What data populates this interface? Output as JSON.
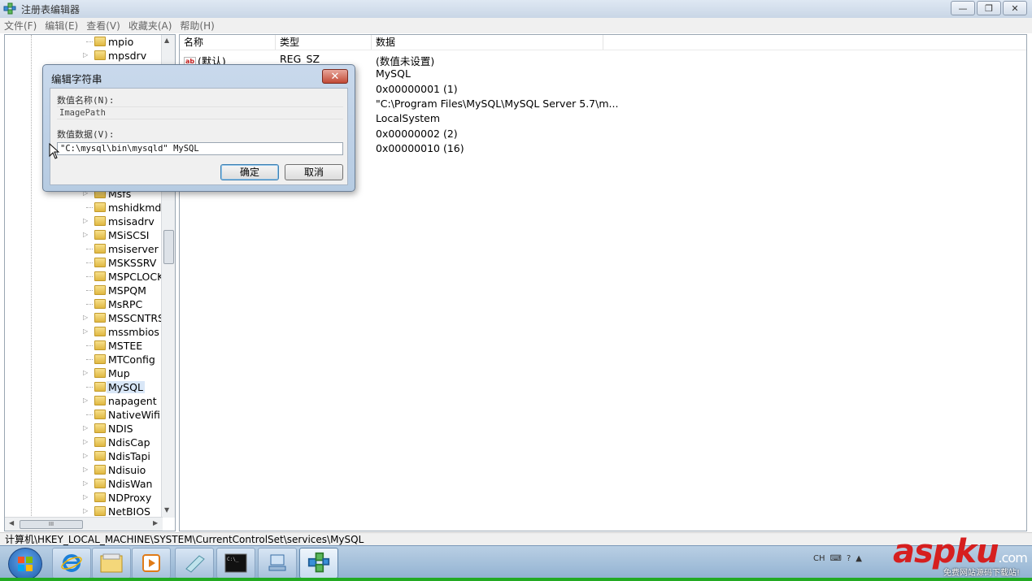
{
  "window": {
    "title": "注册表编辑器",
    "controls": {
      "minimize": "—",
      "maximize": "❐",
      "close": "✕"
    }
  },
  "menubar": {
    "items": [
      "文件(F)",
      "编辑(E)",
      "查看(V)",
      "收藏夹(A)",
      "帮助(H)"
    ]
  },
  "tree": {
    "items": [
      {
        "label": "mpio",
        "expandable": false
      },
      {
        "label": "mpsdrv",
        "expandable": true
      },
      {
        "label": "Msfs",
        "expandable": true
      },
      {
        "label": "mshidkmdf",
        "expandable": false
      },
      {
        "label": "msisadrv",
        "expandable": true
      },
      {
        "label": "MSiSCSI",
        "expandable": true
      },
      {
        "label": "msiserver",
        "expandable": false
      },
      {
        "label": "MSKSSRV",
        "expandable": false
      },
      {
        "label": "MSPCLOCK",
        "expandable": false
      },
      {
        "label": "MSPQM",
        "expandable": false
      },
      {
        "label": "MsRPC",
        "expandable": false
      },
      {
        "label": "MSSCNTRS",
        "expandable": true
      },
      {
        "label": "mssmbios",
        "expandable": true
      },
      {
        "label": "MSTEE",
        "expandable": false
      },
      {
        "label": "MTConfig",
        "expandable": false
      },
      {
        "label": "Mup",
        "expandable": true
      },
      {
        "label": "MySQL",
        "expandable": false,
        "selected": true
      },
      {
        "label": "napagent",
        "expandable": true
      },
      {
        "label": "NativeWifiP",
        "expandable": false
      },
      {
        "label": "NDIS",
        "expandable": true
      },
      {
        "label": "NdisCap",
        "expandable": true
      },
      {
        "label": "NdisTapi",
        "expandable": true
      },
      {
        "label": "Ndisuio",
        "expandable": true
      },
      {
        "label": "NdisWan",
        "expandable": true
      },
      {
        "label": "NDProxy",
        "expandable": true
      },
      {
        "label": "NetBIOS",
        "expandable": true
      }
    ],
    "hscroll_label": "III"
  },
  "list": {
    "columns": [
      "名称",
      "类型",
      "数据"
    ],
    "rows": [
      {
        "name": "(默认)",
        "type": "REG_SZ",
        "data": "(数值未设置)"
      },
      {
        "name": "",
        "type": "",
        "data": "MySQL"
      },
      {
        "name": "",
        "type": "",
        "data": "0x00000001 (1)"
      },
      {
        "name": "",
        "type": "",
        "data": "\"C:\\Program Files\\MySQL\\MySQL Server 5.7\\m..."
      },
      {
        "name": "",
        "type": "",
        "data": "LocalSystem"
      },
      {
        "name": "",
        "type": "",
        "data": "0x00000002 (2)"
      },
      {
        "name": "",
        "type": "",
        "data": "0x00000010 (16)"
      }
    ]
  },
  "dialog": {
    "title": "编辑字符串",
    "close": "✕",
    "name_label": "数值名称(N):",
    "name_value": "ImagePath",
    "data_label": "数值数据(V):",
    "data_value": "\"C:\\mysql\\bin\\mysqld\" MySQL",
    "ok_label": "确定",
    "cancel_label": "取消"
  },
  "statusbar": {
    "path": "计算机\\HKEY_LOCAL_MACHINE\\SYSTEM\\CurrentControlSet\\services\\MySQL"
  },
  "taskbar": {
    "tray_lang": "CH",
    "tray_help": "?",
    "tray_arrow": "▲"
  },
  "watermark": {
    "brand": "aspku",
    "domain": ".com",
    "tagline": "免费网站源码下载站!"
  },
  "colors": {
    "selection": "#d9e7f7",
    "dialog_frame": "#b6cbe2",
    "close_button": "#c24a36",
    "taskbar": "#a8c2dc",
    "watermark_red": "#d61f1f"
  }
}
